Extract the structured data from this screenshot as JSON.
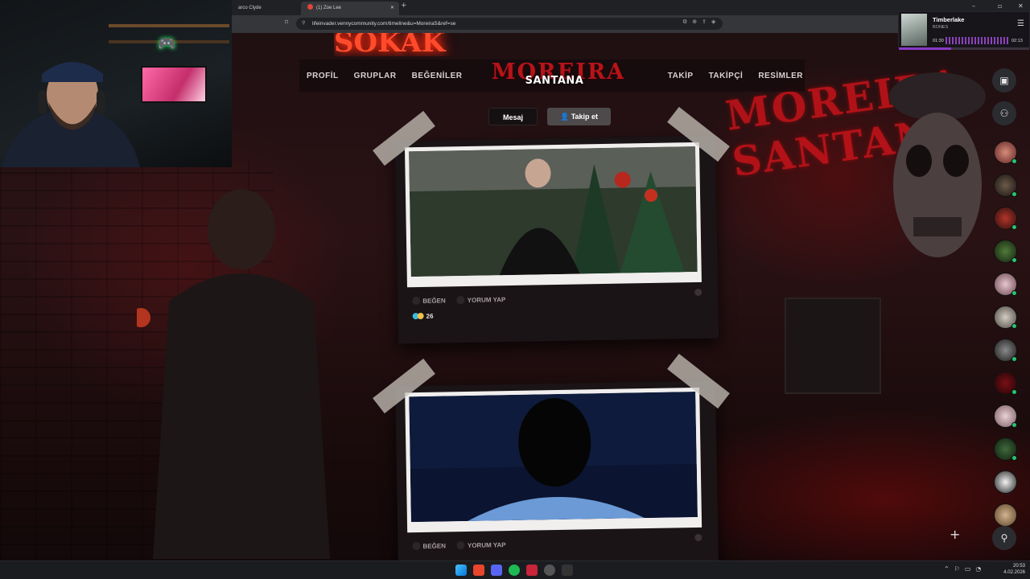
{
  "browser": {
    "tabs": [
      {
        "label": "arco Clyde"
      },
      {
        "label": "(1) Zoe Lee"
      }
    ],
    "new_tab": "+",
    "url": "lifeinvader.vennycommunity.com/timeline&u=MoreiraS&ref=se",
    "window_controls": [
      "–",
      "▫",
      "✕"
    ]
  },
  "background": {
    "neon_sign": "SOKAK",
    "graffiti_line1": "MOREIRA",
    "graffiti_line2": "SANTANA"
  },
  "site": {
    "nav_left": [
      "PROFİL",
      "GRUPLAR",
      "BEĞENİLER"
    ],
    "nav_right": [
      "TAKİP",
      "TAKİPÇİ",
      "RESİMLER"
    ],
    "logo_line1": "MOREIRA",
    "logo_line2": "SANTANA",
    "message_button": "Mesaj",
    "follow_button": "Takip et"
  },
  "posts": [
    {
      "like_label": "BEĞEN",
      "comment_label": "YORUM YAP",
      "like_count": "26"
    },
    {
      "like_label": "BEĞEN",
      "comment_label": "YORUM YAP",
      "like_count": ""
    }
  ],
  "music": {
    "title": "Timberlake",
    "artist": "BONES",
    "elapsed": "01:30",
    "duration": "02:13",
    "progress": 0.4
  },
  "clock": {
    "time": "20:53",
    "date": "4.02.2026"
  },
  "colors": {
    "accent_red": "#b5141a",
    "online": "#28c76f",
    "music_accent": "#8a38c7"
  }
}
